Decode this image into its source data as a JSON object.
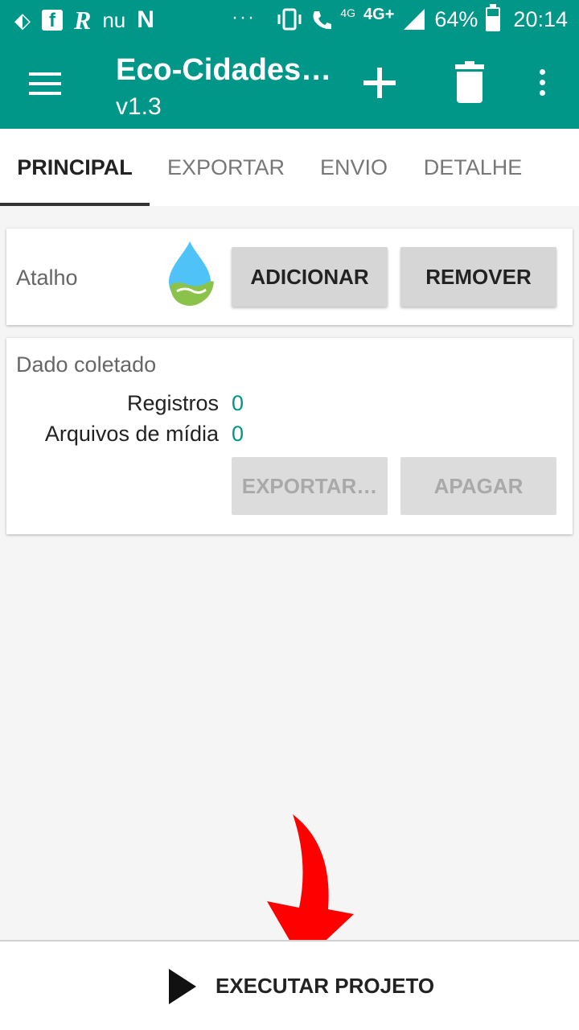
{
  "status_bar": {
    "left_icons": [
      "bb-icon",
      "facebook-icon",
      "r-icon",
      "nu-icon",
      "n-icon"
    ],
    "overflow": "···",
    "network_small": "4G",
    "network": "4G+",
    "battery": "64%",
    "battery_level": 0.64,
    "time": "20:14"
  },
  "app_bar": {
    "title": "Eco-Cidades…",
    "subtitle": "v1.3",
    "color": "#009688"
  },
  "tabs": [
    {
      "label": "PRINCIPAL",
      "active": true
    },
    {
      "label": "EXPORTAR",
      "active": false
    },
    {
      "label": "ENVIO",
      "active": false
    },
    {
      "label": "DETALHE",
      "active": false
    }
  ],
  "shortcut_card": {
    "label": "Atalho",
    "icon": "water-drop-hand-icon",
    "add_button": "ADICIONAR",
    "remove_button": "REMOVER"
  },
  "collected_card": {
    "title": "Dado coletado",
    "records_label": "Registros",
    "records_value": "0",
    "media_label": "Arquivos de mídia",
    "media_value": "0",
    "export_button": "EXPORTAR…",
    "delete_button": "APAGAR"
  },
  "bottom_bar": {
    "execute_label": "EXECUTAR PROJETO",
    "icon": "play-icon"
  },
  "annotation": {
    "icon": "red-arrow-icon",
    "color": "#ff0000"
  }
}
